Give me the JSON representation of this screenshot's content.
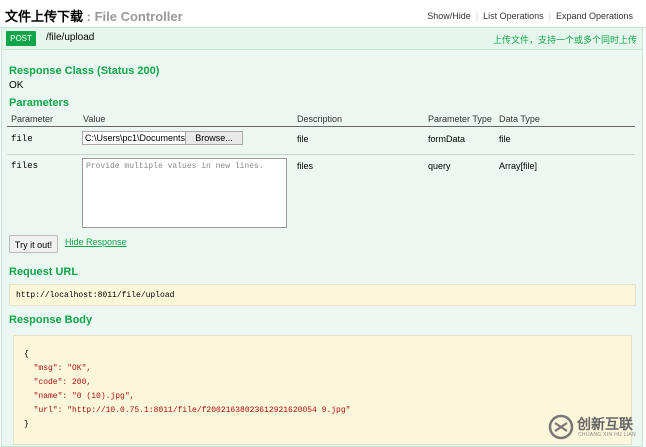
{
  "header": {
    "title_cn": "文件上传下载",
    "title_sep": " : ",
    "title_controller": "File Controller",
    "ops": [
      "Show/Hide",
      "List Operations",
      "Expand Operations"
    ]
  },
  "operation": {
    "method": "POST",
    "path": "/file/upload",
    "summary": "上传文件，支持一个或多个同时上传"
  },
  "response_class": {
    "heading": "Response Class (Status 200)",
    "value": "OK"
  },
  "parameters": {
    "heading": "Parameters",
    "columns": [
      "Parameter",
      "Value",
      "Description",
      "Parameter Type",
      "Data Type"
    ],
    "rows": [
      {
        "name": "file",
        "value": "C:\\Users\\pc1\\Documents",
        "browse": "Browse...",
        "description": "file",
        "param_type": "formData",
        "data_type": "file"
      },
      {
        "name": "files",
        "placeholder": "Provide multiple values in new lines.",
        "description": "files",
        "param_type": "query",
        "data_type": "Array[file]"
      }
    ]
  },
  "actions": {
    "try_label": "Try it out!",
    "hide_label": "Hide Response"
  },
  "request_url": {
    "heading": "Request URL",
    "value": "http://localhost:8011/file/upload"
  },
  "response_body": {
    "heading": "Response Body",
    "lines": [
      "{",
      "  \"msg\": \"OK\",",
      "  \"code\": 200,",
      "  \"name\": \"0 (10).jpg\",",
      "  \"url\": \"http://10.0.75.1:8011/file/f20021638023612921620054 9.jpg\"",
      "}"
    ]
  },
  "watermark": {
    "text": "创新互联",
    "sub": "CHUANG XIN HU LIAN",
    "icon": "logo-icon"
  },
  "colors": {
    "accent": "#10a54a",
    "panel_bg": "#ebf7f0",
    "code_bg": "#fcf6db"
  }
}
